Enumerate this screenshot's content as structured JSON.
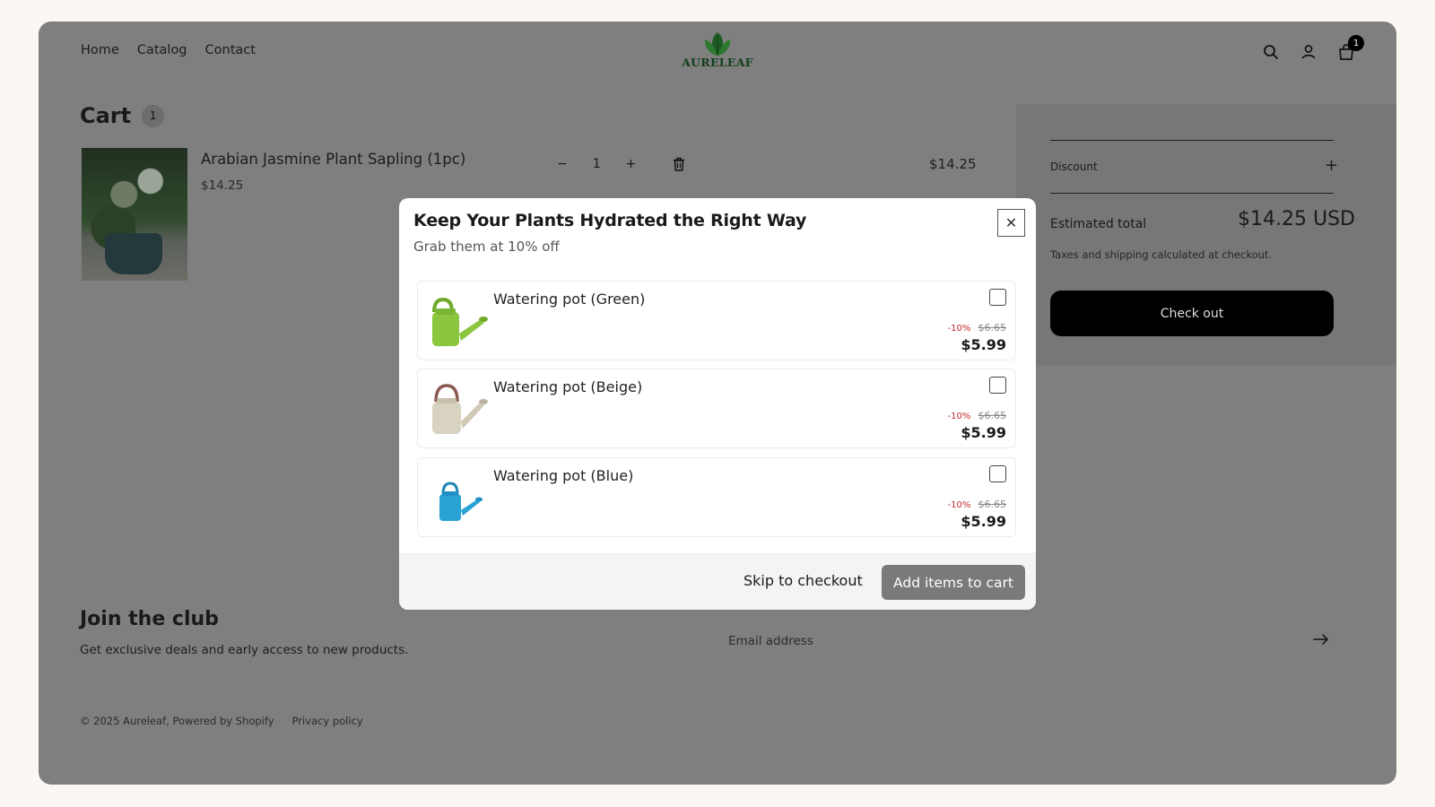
{
  "header": {
    "nav": [
      "Home",
      "Catalog",
      "Contact"
    ],
    "logo_text": "AURELEAF",
    "cart_count": "1"
  },
  "cart": {
    "title": "Cart",
    "count": "1",
    "item": {
      "name": "Arabian Jasmine Plant Sapling (1pc)",
      "price": "$14.25",
      "quantity": "1",
      "line_total": "$14.25"
    }
  },
  "summary": {
    "discount_label": "Discount",
    "estimated_label": "Estimated total",
    "estimated_value": "$14.25 USD",
    "taxes_note": "Taxes and shipping calculated at checkout.",
    "checkout_label": "Check out"
  },
  "footer": {
    "club_title": "Join the club",
    "club_sub": "Get exclusive deals and early access to new products.",
    "email_placeholder": "Email address",
    "copyright": "© 2025 Aureleaf, Powered by Shopify",
    "privacy": "Privacy policy"
  },
  "modal": {
    "title": "Keep Your Plants Hydrated the Right Way",
    "subtitle": "Grab them at 10% off",
    "offers": [
      {
        "name": "Watering pot (Green)",
        "discount": "-10%",
        "compare_price": "$6.65",
        "price": "$5.99",
        "color": "#8cc63f"
      },
      {
        "name": "Watering pot (Beige)",
        "discount": "-10%",
        "compare_price": "$6.65",
        "price": "$5.99",
        "color": "#d8d2c0"
      },
      {
        "name": "Watering pot (Blue)",
        "discount": "-10%",
        "compare_price": "$6.65",
        "price": "$5.99",
        "color": "#29a3d4"
      }
    ],
    "skip_label": "Skip to checkout",
    "add_label": "Add items to cart"
  }
}
